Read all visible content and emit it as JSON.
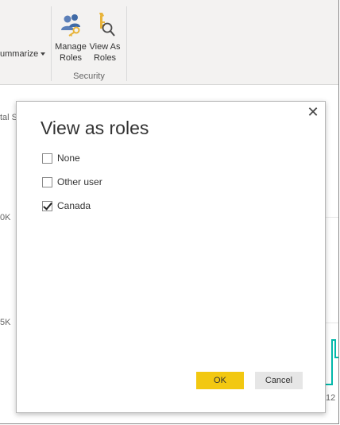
{
  "ribbon": {
    "summarize_label": "ummarize",
    "manage_roles_line1": "Manage",
    "manage_roles_line2": "Roles",
    "view_as_roles_line1": "View As",
    "view_as_roles_line2": "Roles",
    "group_label": "Security"
  },
  "background": {
    "partial_label": "tal S",
    "tick_upper": "0K",
    "tick_lower": "5K",
    "tick_axis": "12"
  },
  "dialog": {
    "title": "View as roles",
    "close_glyph": "✕",
    "roles": [
      {
        "label": "None",
        "checked": false
      },
      {
        "label": "Other user",
        "checked": false
      },
      {
        "label": "Canada",
        "checked": true
      }
    ],
    "ok_label": "OK",
    "cancel_label": "Cancel"
  },
  "colors": {
    "primary_button": "#f2c811",
    "secondary_button": "#e6e6e6",
    "checkbox_tick": "#222222",
    "chart_line": "#01b8aa"
  },
  "icons": {
    "manage_roles": "people-key-icon",
    "view_as_roles": "document-magnifier-icon"
  }
}
